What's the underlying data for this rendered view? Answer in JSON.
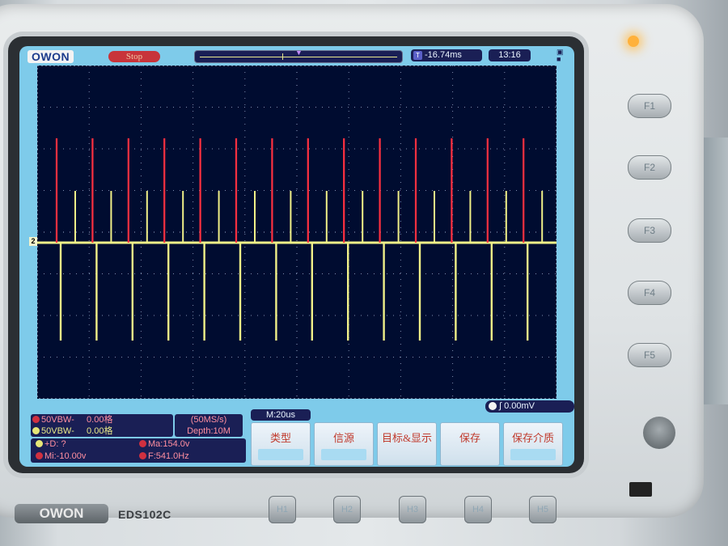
{
  "screen": {
    "brand_logo": "OWON",
    "run_state": "Stop",
    "trigger_time": "-16.74ms",
    "clock": "13:16",
    "channel2_marker": "2",
    "trigger_level": "0.00mV",
    "timebase": "M:20us",
    "channels": [
      {
        "label": "50VBW-",
        "value": "0.00格"
      },
      {
        "label": "50VBW-",
        "value": "0.00格"
      }
    ],
    "sample_rate": "(50MS/s)",
    "depth": "Depth:10M",
    "measurements": {
      "delta": "+D:  ?",
      "ma": "Ma:154.0v",
      "mi": "Mi:-10.00v",
      "freq": "F:541.0Hz"
    },
    "menu": [
      {
        "label": "类型"
      },
      {
        "label": "信源"
      },
      {
        "label": "目标&显示"
      },
      {
        "label": "保存"
      },
      {
        "label": "保存介质"
      }
    ],
    "colors": {
      "ch1": "#ff3040",
      "ch2": "#f0f088",
      "grid": "#7f8fb0",
      "screen_bg": "#000c30"
    }
  },
  "hardware": {
    "brand": "OWON",
    "model": "EDS102C",
    "side_buttons": [
      "F1",
      "F2",
      "F3",
      "F4",
      "F5"
    ],
    "bottom_buttons": [
      "H1",
      "H2",
      "H3",
      "H4",
      "H5"
    ]
  }
}
